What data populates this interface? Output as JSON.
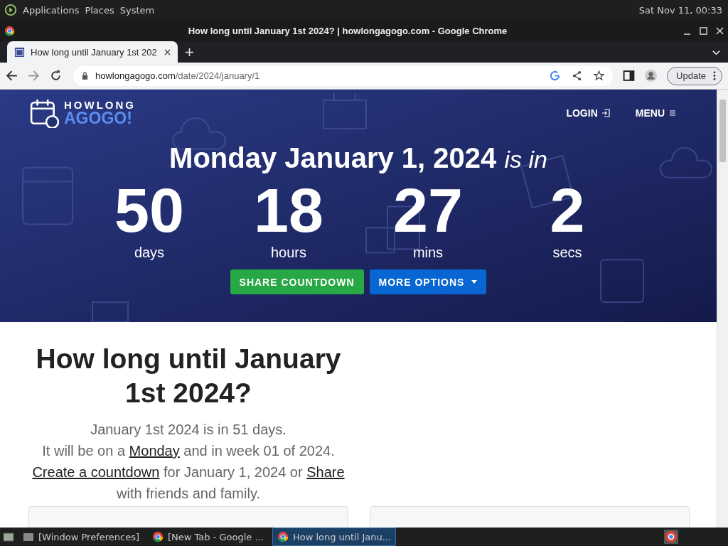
{
  "top_panel": {
    "menus": [
      "Applications",
      "Places",
      "System"
    ],
    "clock": "Sat Nov 11, 00:33"
  },
  "window": {
    "title": "How long until January 1st 2024? | howlongagogo.com - Google Chrome"
  },
  "tabs": [
    {
      "label": "How long until January 1st 202",
      "selected": true
    }
  ],
  "address_bar": {
    "domain": "howlongagogo.com",
    "path": "/date/2024/january/1"
  },
  "update_button": "Update",
  "site": {
    "logo_top": "HOWLONG",
    "logo_bottom": "AGOGO!",
    "nav": [
      "LOGIN",
      "MENU"
    ],
    "headline": "Monday January 1, 2024",
    "headline_suffix": "is in",
    "countdown": [
      {
        "value": "50",
        "unit": "days"
      },
      {
        "value": "18",
        "unit": "hours"
      },
      {
        "value": "27",
        "unit": "mins"
      },
      {
        "value": "2",
        "unit": "secs"
      }
    ],
    "buttons": [
      {
        "label": "SHARE COUNTDOWN",
        "kind": "share"
      },
      {
        "label": "MORE OPTIONS",
        "kind": "dropdown"
      }
    ],
    "heading": "How long until January 1st 2024?",
    "intro": [
      [
        {
          "kind": "text",
          "text": "January 1st 2024 is in 51 days."
        }
      ],
      [
        {
          "kind": "text",
          "text": "It will be on a "
        },
        {
          "kind": "link",
          "text": "Monday"
        },
        {
          "kind": "text",
          "text": " and in week 01 of 2024."
        }
      ],
      [
        {
          "kind": "link",
          "text": "Create a countdown"
        },
        {
          "kind": "text",
          "text": " for January 1, 2024 or "
        },
        {
          "kind": "link",
          "text": "Share"
        }
      ],
      [
        {
          "kind": "text",
          "text": "with friends and family."
        }
      ]
    ]
  },
  "taskbar": [
    {
      "label": "[Window Preferences]",
      "kind": "window",
      "selected": false
    },
    {
      "label": "[New Tab - Google ...",
      "kind": "chrome",
      "selected": false
    },
    {
      "label": "How long until Janu...",
      "kind": "chrome",
      "selected": true
    }
  ]
}
